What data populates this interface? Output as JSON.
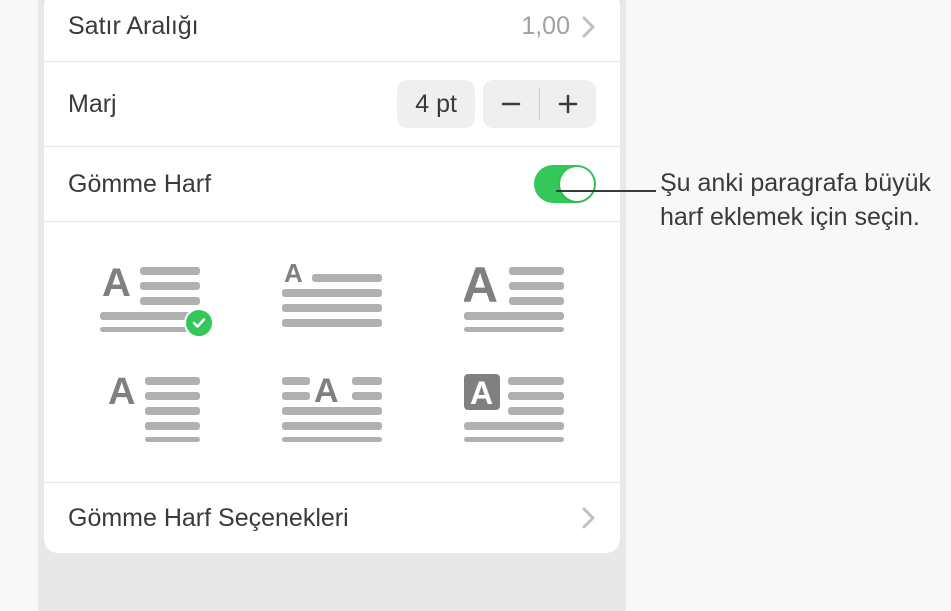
{
  "rows": {
    "lineSpacing": {
      "label": "Satır Aralığı",
      "value": "1,00"
    },
    "margin": {
      "label": "Marj",
      "value": "4 pt"
    },
    "dropCap": {
      "label": "Gömme Harf",
      "enabled": true
    },
    "dropCapOptions": {
      "label": "Gömme Harf Seçenekleri"
    }
  },
  "dropCapStyles": {
    "selectedIndex": 0
  },
  "annotation": "Şu anki paragrafa büyük harf eklemek için seçin."
}
